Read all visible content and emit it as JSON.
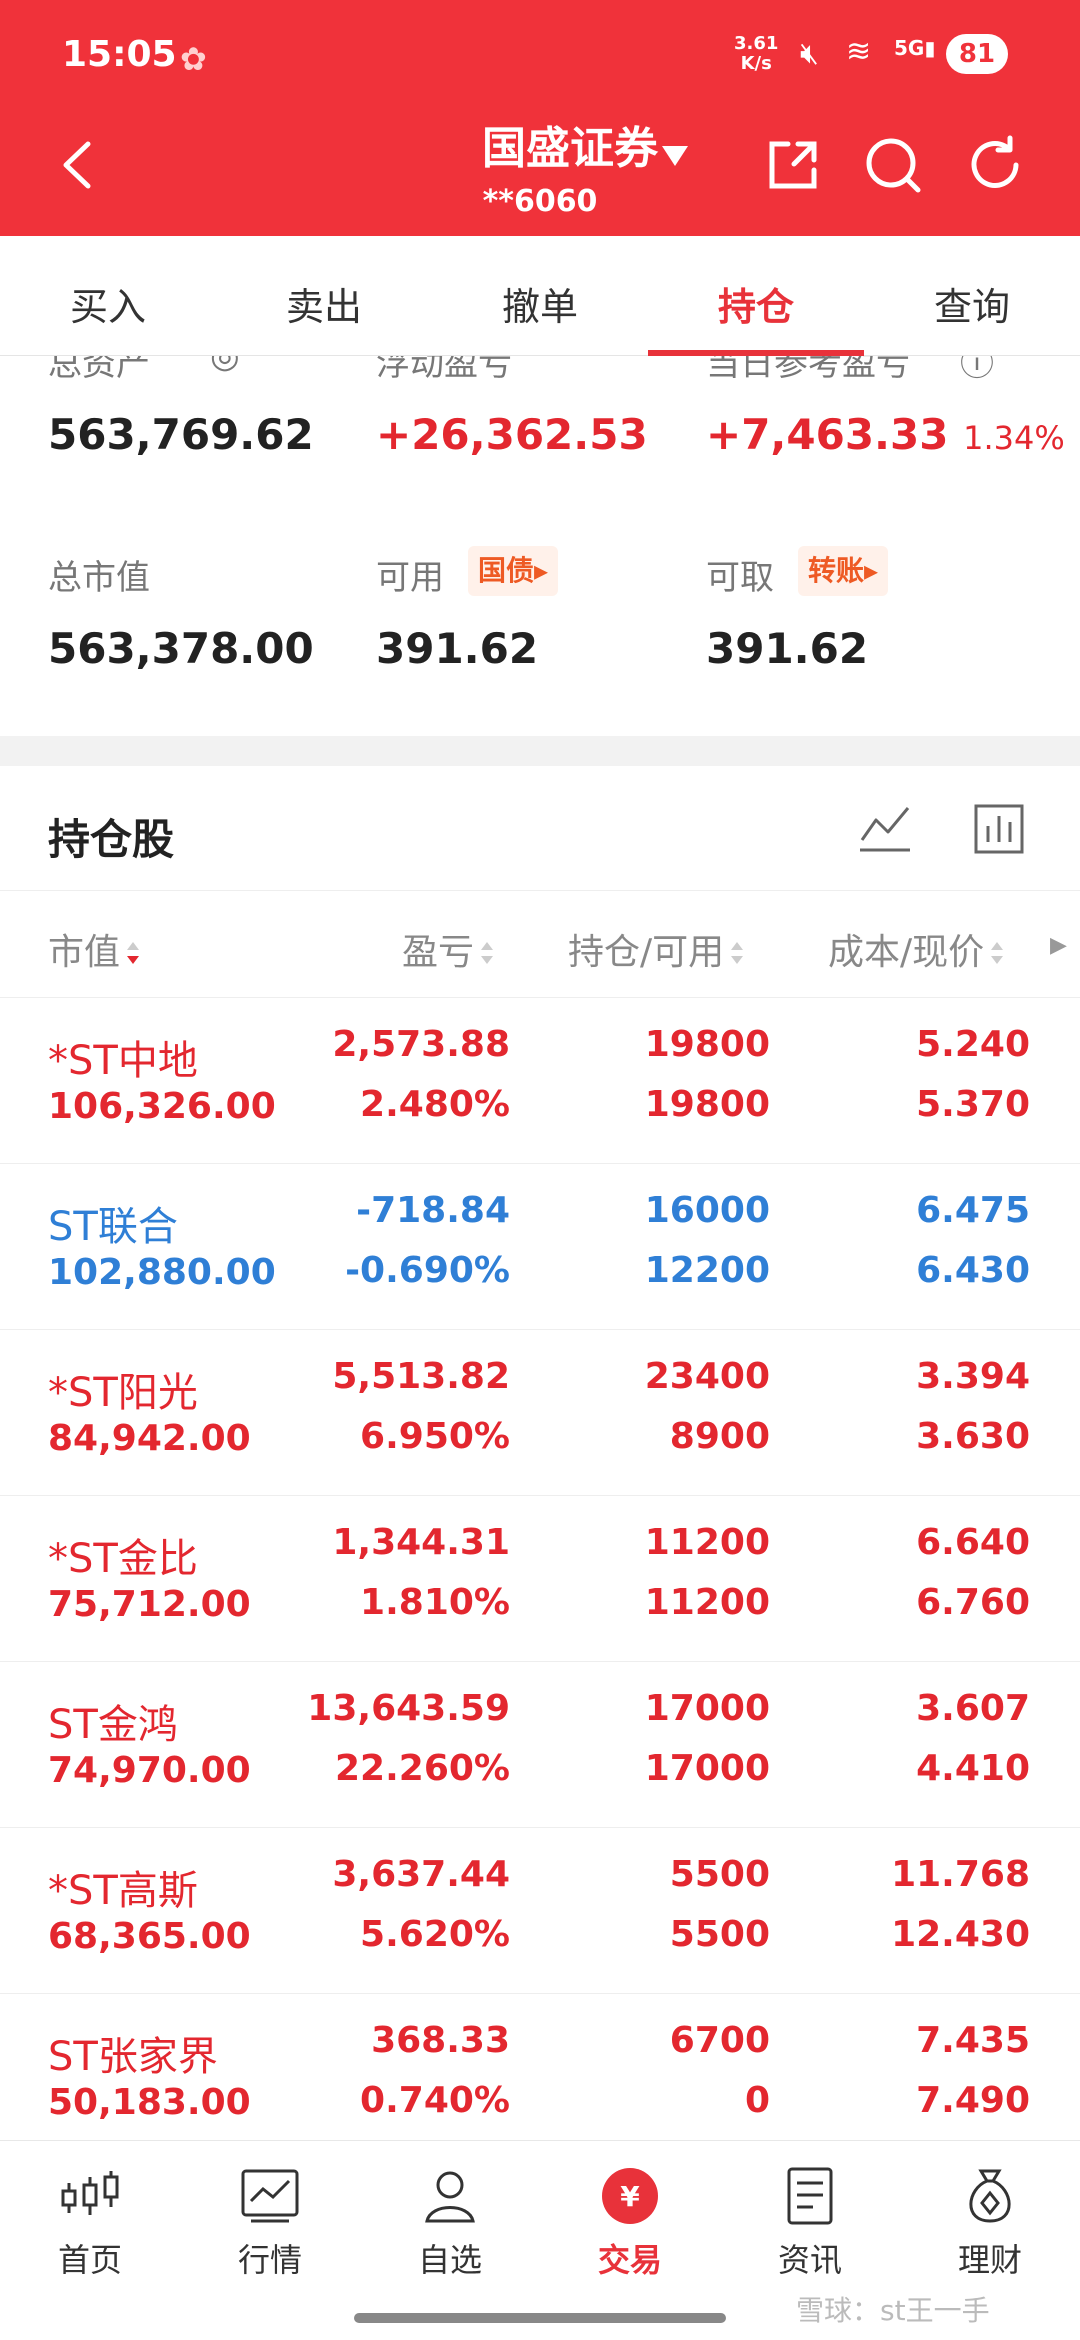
{
  "status": {
    "time": "15:05",
    "speed_value": "3.61",
    "speed_unit": "K/s",
    "signal_label": "5G",
    "battery": "81"
  },
  "header": {
    "title": "国盛证券",
    "account": "**6060"
  },
  "tabs": [
    {
      "label": "买入"
    },
    {
      "label": "卖出"
    },
    {
      "label": "撤单"
    },
    {
      "label": "持仓"
    },
    {
      "label": "查询"
    }
  ],
  "summary": {
    "total_assets_label": "总资产",
    "total_assets": "563,769.62",
    "floating_pl_label": "浮动盈亏",
    "floating_pl": "+26,362.53",
    "daily_pl_label": "当日参考盈亏",
    "daily_pl": "+7,463.33",
    "daily_pl_pct": "1.34%",
    "market_value_label": "总市值",
    "market_value": "563,378.00",
    "available_label": "可用",
    "available": "391.62",
    "bond_chip": "国债▸",
    "withdrawable_label": "可取",
    "withdrawable": "391.62",
    "transfer_chip": "转账▸"
  },
  "holdings": {
    "title": "持仓股",
    "columns": {
      "market_value": "市值",
      "pl": "盈亏",
      "position": "持仓/可用",
      "cost_price": "成本/现价"
    },
    "rows": [
      {
        "name": "*ST中地",
        "mv": "106,326.00",
        "pl": "2,573.88",
        "pl_pct": "2.480%",
        "pos": "19800",
        "avail": "19800",
        "cost": "5.240",
        "price": "5.370",
        "color": "red"
      },
      {
        "name": "ST联合",
        "mv": "102,880.00",
        "pl": "-718.84",
        "pl_pct": "-0.690%",
        "pos": "16000",
        "avail": "12200",
        "cost": "6.475",
        "price": "6.430",
        "color": "blue"
      },
      {
        "name": "*ST阳光",
        "mv": "84,942.00",
        "pl": "5,513.82",
        "pl_pct": "6.950%",
        "pos": "23400",
        "avail": "8900",
        "cost": "3.394",
        "price": "3.630",
        "color": "red"
      },
      {
        "name": "*ST金比",
        "mv": "75,712.00",
        "pl": "1,344.31",
        "pl_pct": "1.810%",
        "pos": "11200",
        "avail": "11200",
        "cost": "6.640",
        "price": "6.760",
        "color": "red"
      },
      {
        "name": "ST金鸿",
        "mv": "74,970.00",
        "pl": "13,643.59",
        "pl_pct": "22.260%",
        "pos": "17000",
        "avail": "17000",
        "cost": "3.607",
        "price": "4.410",
        "color": "red"
      },
      {
        "name": "*ST高斯",
        "mv": "68,365.00",
        "pl": "3,637.44",
        "pl_pct": "5.620%",
        "pos": "5500",
        "avail": "5500",
        "cost": "11.768",
        "price": "12.430",
        "color": "red"
      },
      {
        "name": "ST张家界",
        "mv": "50,183.00",
        "pl": "368.33",
        "pl_pct": "0.740%",
        "pos": "6700",
        "avail": "0",
        "cost": "7.435",
        "price": "7.490",
        "color": "red"
      }
    ]
  },
  "bottom_nav": [
    {
      "label": "首页",
      "icon": "candlestick-icon"
    },
    {
      "label": "行情",
      "icon": "chart-line-icon"
    },
    {
      "label": "自选",
      "icon": "person-icon"
    },
    {
      "label": "交易",
      "icon": "yen-circle-icon"
    },
    {
      "label": "资讯",
      "icon": "document-icon"
    },
    {
      "label": "理财",
      "icon": "money-bag-icon"
    }
  ],
  "watermark": "雪球：st王一手",
  "colors": {
    "brand_red": "#f0323a",
    "gain_red": "#e3272f",
    "loss_blue": "#2f7fd6"
  }
}
